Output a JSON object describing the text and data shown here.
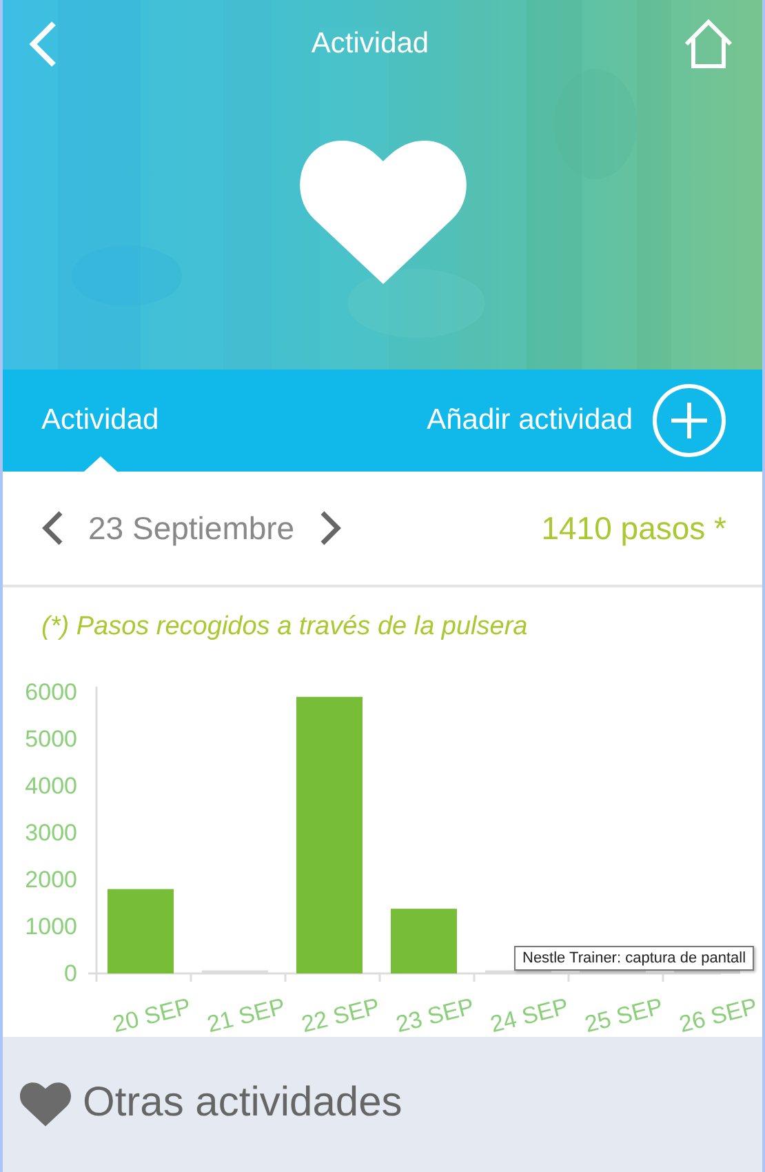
{
  "header": {
    "title": "Actividad"
  },
  "tabs": [
    {
      "label": "Actividad",
      "selected": true
    }
  ],
  "add_button": {
    "label": "Añadir actividad"
  },
  "date_row": {
    "date": "23 Septiembre",
    "steps": "1410 pasos *"
  },
  "note": "(*) Pasos recogidos a través de la pulsera",
  "chart": {
    "chart_data": {
      "type": "bar",
      "categories": [
        "20 SEP",
        "21 SEP",
        "22 SEP",
        "23 SEP",
        "24 SEP",
        "25 SEP",
        "26 SEP"
      ],
      "series": [
        {
          "color": "#77bd37",
          "values": [
            1800,
            0,
            5900,
            1380,
            0,
            0,
            0
          ]
        }
      ],
      "ylim": [
        0,
        6000
      ],
      "yticks": [
        0,
        1000,
        2000,
        3000,
        4000,
        5000,
        6000
      ]
    }
  },
  "tooltip": "Nestle Trainer: captura de pantall",
  "section": {
    "title": "Otras actividades"
  }
}
